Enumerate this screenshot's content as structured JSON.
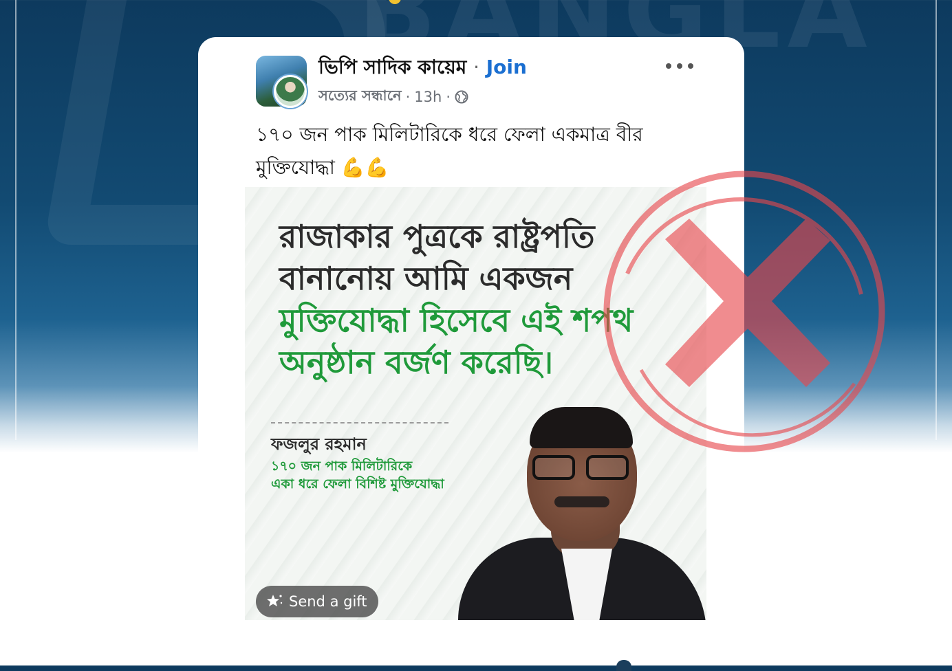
{
  "background": {
    "watermark_text": "BANGLA",
    "accent_color": "#0d3a5e"
  },
  "post": {
    "group_name": "ভিপি সাদিক কায়েম",
    "separator": "·",
    "join_label": "Join",
    "author": "সত্যের সন্ধানে",
    "time": "13h",
    "visibility_icon": "globe-icon",
    "text_line1": "১৭০ জন পাক মিলিটারিকে ধরে ফেলা একমাত্র বীর",
    "text_line2": "মুক্তিযোদ্ধা",
    "text_emoji": "💪💪"
  },
  "image": {
    "line1": "রাজাকার পুত্রকে রাষ্ট্রপতি",
    "line2": "বানানোয় আমি একজন",
    "line3": "মুক্তিযোদ্ধা হিসেবে এই শপথ",
    "line4": "অনুষ্ঠান বর্জণ করেছি।",
    "name": "ফজলুর রহমান",
    "desc_line1": "১৭০ জন পাক মিলিটারিকে",
    "desc_line2": "একা ধরে ফেলা বিশিষ্ট মুক্তিযোদ্ধা"
  },
  "gift": {
    "label": "Send a gift",
    "icon": "gift-sparkle-icon"
  },
  "stamp": {
    "meaning": "false",
    "color": "#e8474c"
  }
}
